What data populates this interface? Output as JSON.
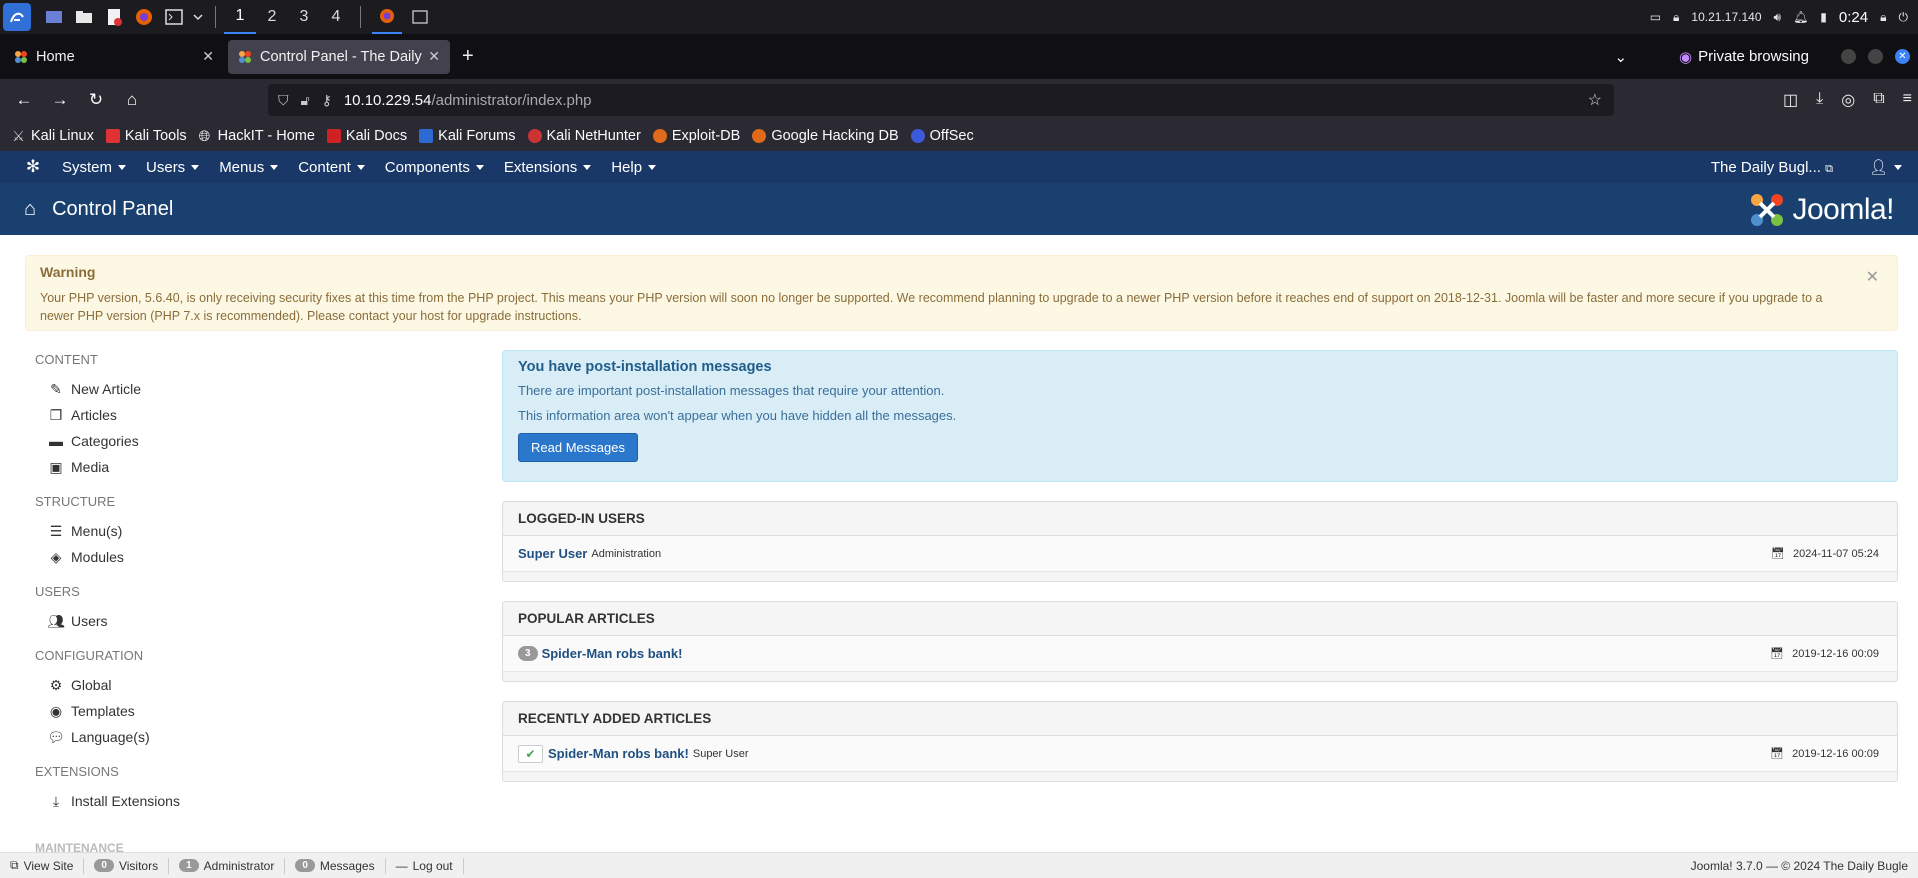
{
  "taskbar": {
    "workspaces": [
      "1",
      "2",
      "3",
      "4"
    ],
    "ip": "10.21.17.140",
    "clock": "0:24"
  },
  "tabs": {
    "home_label": "Home",
    "active_label": "Control Panel - The Daily",
    "private_label": "Private browsing"
  },
  "urlbar": {
    "host": "10.10.229.54",
    "path": "/administrator/index.php"
  },
  "bookmarks": [
    "Kali Linux",
    "Kali Tools",
    "HackIT - Home",
    "Kali Docs",
    "Kali Forums",
    "Kali NetHunter",
    "Exploit-DB",
    "Google Hacking DB",
    "OffSec"
  ],
  "jnav": {
    "menus": [
      "System",
      "Users",
      "Menus",
      "Content",
      "Components",
      "Extensions",
      "Help"
    ],
    "site_link": "The Daily Bugl..."
  },
  "header": {
    "title": "Control Panel",
    "brand": "Joomla!"
  },
  "warning": {
    "title": "Warning",
    "text": "Your PHP version, 5.6.40, is only receiving security fixes at this time from the PHP project. This means your PHP version will soon no longer be supported. We recommend planning to upgrade to a newer PHP version before it reaches end of support on 2018-12-31. Joomla will be faster and more secure if you upgrade to a newer PHP version (PHP 7.x is recommended). Please contact your host for upgrade instructions."
  },
  "sidebar": {
    "content": {
      "title": "CONTENT",
      "items": [
        "New Article",
        "Articles",
        "Categories",
        "Media"
      ]
    },
    "structure": {
      "title": "STRUCTURE",
      "items": [
        "Menu(s)",
        "Modules"
      ]
    },
    "users": {
      "title": "USERS",
      "items": [
        "Users"
      ]
    },
    "configuration": {
      "title": "CONFIGURATION",
      "items": [
        "Global",
        "Templates",
        "Language(s)"
      ]
    },
    "extensions": {
      "title": "EXTENSIONS",
      "items": [
        "Install Extensions"
      ]
    },
    "maintenance": {
      "title": "MAINTENANCE"
    }
  },
  "postinstall": {
    "title": "You have post-installation messages",
    "line1": "There are important post-installation messages that require your attention.",
    "line2": "This information area won't appear when you have hidden all the messages.",
    "button": "Read Messages"
  },
  "logged_in": {
    "title": "LOGGED-IN USERS",
    "user": "Super User",
    "role": "Administration",
    "date": "2024-11-07 05:24"
  },
  "popular": {
    "title": "POPULAR ARTICLES",
    "hits": "3",
    "article": "Spider-Man robs bank!",
    "date": "2019-12-16 00:09"
  },
  "recent": {
    "title": "RECENTLY ADDED ARTICLES",
    "article": "Spider-Man robs bank!",
    "author": "Super User",
    "date": "2019-12-16 00:09"
  },
  "statusbar": {
    "view_site": "View Site",
    "visitors_count": "0",
    "visitors": "Visitors",
    "admin_count": "1",
    "admin": "Administrator",
    "messages_count": "0",
    "messages": "Messages",
    "logout": "Log out",
    "version": "Joomla! 3.7.0  —  © 2024 The Daily Bugle"
  },
  "colors": {
    "jnav_bg": "#1a3867",
    "jheader_bg": "#1a4070",
    "link": "#205081",
    "warning_bg": "#fcf8e3",
    "info_bg": "#d9edf7"
  }
}
